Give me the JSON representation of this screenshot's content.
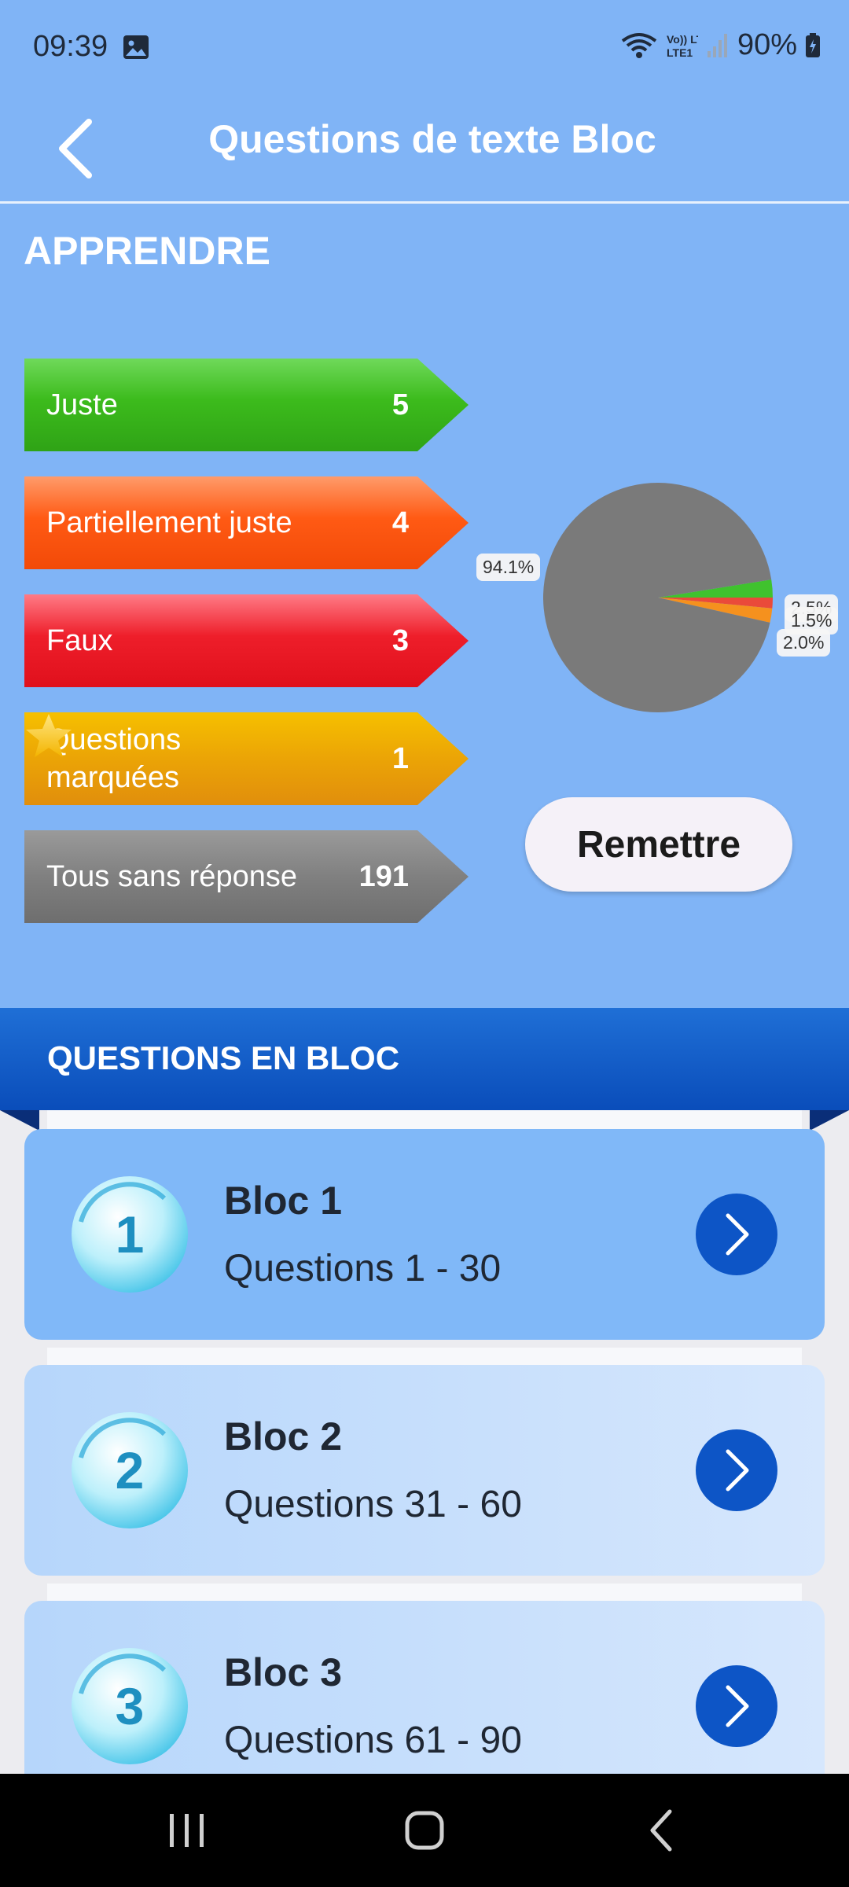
{
  "status_bar": {
    "time": "09:39",
    "battery": "90%",
    "icons": [
      "image-icon",
      "wifi-icon",
      "volte-icon",
      "signal-icon",
      "battery-charging-icon"
    ],
    "volte_text": "Vo)) LTE1"
  },
  "app_bar": {
    "title": "Questions de texte Bloc",
    "back_icon": "chevron-left-icon"
  },
  "learn": {
    "title": "APPRENDRE",
    "stats": [
      {
        "label": "Juste",
        "count": "5",
        "color": "#3cbb1c"
      },
      {
        "label": "Partiellement juste",
        "count": "4",
        "color": "#ff5a14"
      },
      {
        "label": "Faux",
        "count": "3",
        "color": "#ee1e2a"
      },
      {
        "label": "Questions marquées",
        "count": "1",
        "color": "#eba406",
        "icon": "star-icon"
      },
      {
        "label": "Tous sans réponse",
        "count": "191",
        "color": "#808080"
      }
    ],
    "reset_label": "Remettre"
  },
  "chart_data": {
    "type": "pie",
    "slices": [
      {
        "label": "94.1%",
        "value": 94.1,
        "color": "#7a7a7a"
      },
      {
        "label": "2.5%",
        "value": 2.5,
        "color": "#40c22e"
      },
      {
        "label": "1.5%",
        "value": 1.5,
        "color": "#ea4a3a"
      },
      {
        "label": "2.0%",
        "value": 2.0,
        "color": "#f5911e"
      }
    ]
  },
  "blocks": {
    "header": "QUESTIONS EN BLOC",
    "items": [
      {
        "number": "1",
        "title": "Bloc 1",
        "subtitle": "Questions 1 - 30"
      },
      {
        "number": "2",
        "title": "Bloc 2",
        "subtitle": "Questions 31 - 60"
      },
      {
        "number": "3",
        "title": "Bloc 3",
        "subtitle": "Questions 61 - 90"
      }
    ],
    "arrow_icon": "chevron-right-icon"
  },
  "nav_bar": {
    "buttons": [
      "recents-icon",
      "home-icon",
      "back-icon"
    ]
  }
}
